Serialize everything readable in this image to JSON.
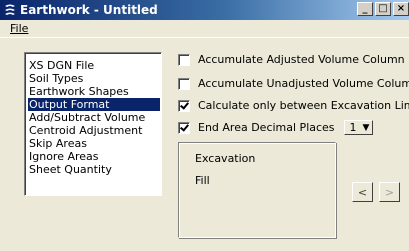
{
  "window": {
    "title": "Earthwork - Untitled",
    "buttons": [
      "minimize",
      "maximize",
      "close"
    ]
  },
  "menu": {
    "file": "File"
  },
  "list": {
    "items": [
      "XS DGN File",
      "Soil Types",
      "Earthwork Shapes",
      "Output Format",
      "Add/Subtract Volume",
      "Centroid Adjustment",
      "Skip Areas",
      "Ignore Areas",
      "Sheet Quantity"
    ],
    "selected": "Output Format"
  },
  "options": {
    "adjusted": {
      "label": "Accumulate Adjusted Volume Column",
      "checked": false
    },
    "unadjusted": {
      "label": "Accumulate Unadjusted Volume Column",
      "checked": false
    },
    "excavation_limits": {
      "label": "Calculate only between Excavation Limits",
      "checked": true
    },
    "decimal_places": {
      "label": "End Area Decimal Places",
      "checked": true,
      "value": "1"
    }
  },
  "group": {
    "line1": "Excavation",
    "line2": "Fill"
  },
  "nav": {
    "prev": "<",
    "next": ">"
  },
  "icons": {
    "app": "earthwork-app-icon",
    "dropdown": "chevron-down-icon"
  }
}
